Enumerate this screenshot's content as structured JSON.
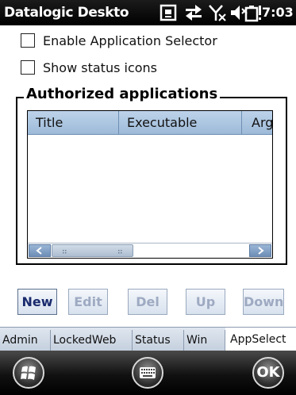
{
  "status_bar": {
    "title": "Datalogic Deskto",
    "time": "7:03",
    "icons": [
      "sip-input-icon",
      "connectivity-arrows-icon",
      "no-signal-antenna-icon",
      "speaker-muted-icon",
      "battery-warning-icon"
    ]
  },
  "options": {
    "enable_app_selector": {
      "label": "Enable Application Selector",
      "checked": false
    },
    "show_status_icons": {
      "label": "Show status icons",
      "checked": false
    }
  },
  "authorized": {
    "title": "Authorized applications",
    "columns": [
      "Title",
      "Executable",
      "Arg"
    ],
    "rows": []
  },
  "buttons": {
    "new": "New",
    "edit": "Edit",
    "del": "Del",
    "up": "Up",
    "down": "Down"
  },
  "tabs": [
    "Admin",
    "LockedWeb",
    "Status",
    "Win",
    "AppSelect"
  ],
  "active_tab": "AppSelect",
  "command_bar": {
    "ok": "OK",
    "left_icon": "windows-start-icon",
    "center_icon": "keyboard-icon"
  },
  "colors": {
    "title_bar": "#000000",
    "header": "#b2c9e2",
    "button_enabled": "#1a2b6e",
    "button_disabled": "#9eaac2"
  }
}
